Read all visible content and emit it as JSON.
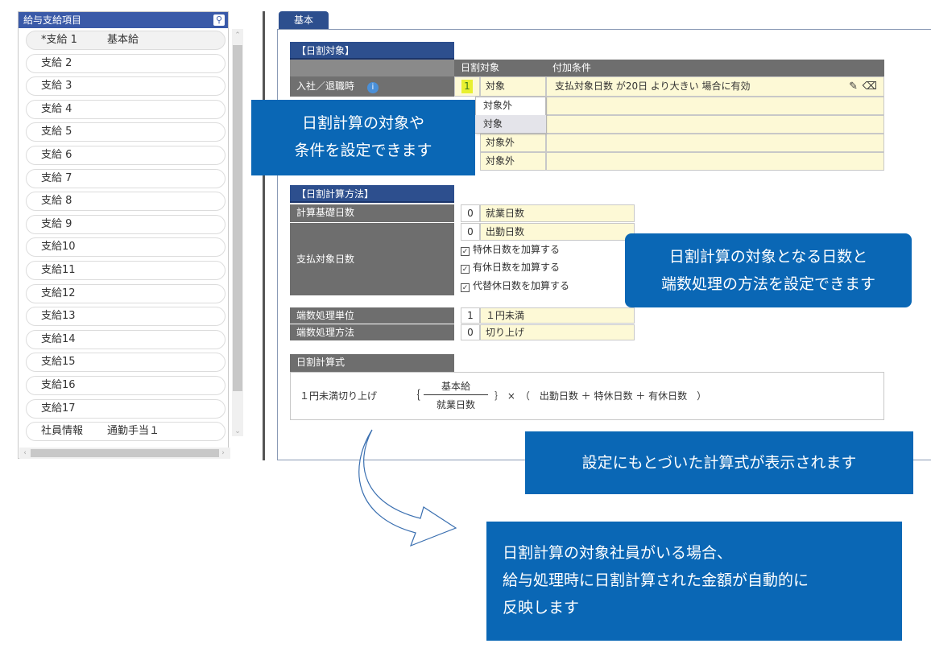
{
  "left_panel": {
    "title": "給与支給項目",
    "search_icon": "search-icon",
    "items": [
      {
        "label": "*支給 1",
        "name": "基本給"
      },
      {
        "label": "支給 2",
        "name": ""
      },
      {
        "label": "支給 3",
        "name": ""
      },
      {
        "label": "支給 4",
        "name": ""
      },
      {
        "label": "支給 5",
        "name": ""
      },
      {
        "label": "支給 6",
        "name": ""
      },
      {
        "label": "支給 7",
        "name": ""
      },
      {
        "label": "支給 8",
        "name": ""
      },
      {
        "label": "支給 9",
        "name": ""
      },
      {
        "label": "支給10",
        "name": ""
      },
      {
        "label": "支給11",
        "name": ""
      },
      {
        "label": "支給12",
        "name": ""
      },
      {
        "label": "支給13",
        "name": ""
      },
      {
        "label": "支給14",
        "name": ""
      },
      {
        "label": "支給15",
        "name": ""
      },
      {
        "label": "支給16",
        "name": ""
      },
      {
        "label": "支給17",
        "name": ""
      },
      {
        "label": "社員情報",
        "name": "通勤手当１"
      }
    ]
  },
  "tab": {
    "label": "基本"
  },
  "section1": {
    "header": "【日割対象】",
    "col_target": "日割対象",
    "col_condition": "付加条件",
    "row1": {
      "label": "入社／退職時",
      "code": "1",
      "value": "対象",
      "condition": "支払対象日数 が20日 より大きい 場合に有効"
    },
    "dropdown": [
      "対象外",
      "対象"
    ],
    "extra_rows": [
      "対象外",
      "対象外"
    ]
  },
  "section2": {
    "header": "【日割計算方法】",
    "base_label": "計算基礎日数",
    "base_code": "0",
    "base_value": "就業日数",
    "pay_label": "支払対象日数",
    "pay_code": "0",
    "pay_value": "出勤日数",
    "checks": [
      "特休日数を加算する",
      "有休日数を加算する",
      "代替休日数を加算する"
    ],
    "round_unit_label": "端数処理単位",
    "round_unit_code": "1",
    "round_unit_value": "１円未満",
    "round_method_label": "端数処理方法",
    "round_method_code": "0",
    "round_method_value": "切り上げ"
  },
  "formula": {
    "header": "日割計算式",
    "prefix": "１円未満切り上げ",
    "numerator": "基本給",
    "denominator": "就業日数",
    "rest": "｝ ×　（　出勤日数 ＋ 特休日数 ＋ 有休日数　）",
    "open": "｛"
  },
  "callouts": {
    "c1_line1": "日割計算の対象や",
    "c1_line2": "条件を設定できます",
    "c2_line1": "日割計算の対象となる日数と",
    "c2_line2": "端数処理の方法を設定できます",
    "c3": "設定にもとづいた計算式が表示されます",
    "c4_line1": "日割計算の対象社員がいる場合、",
    "c4_line2": "給与処理時に日割計算された金額が自動的に",
    "c4_line3": "反映します"
  },
  "colors": {
    "accent": "#0a67b5",
    "header_blue": "#2d4f8e",
    "cell_yellow": "#fdf9d6"
  }
}
